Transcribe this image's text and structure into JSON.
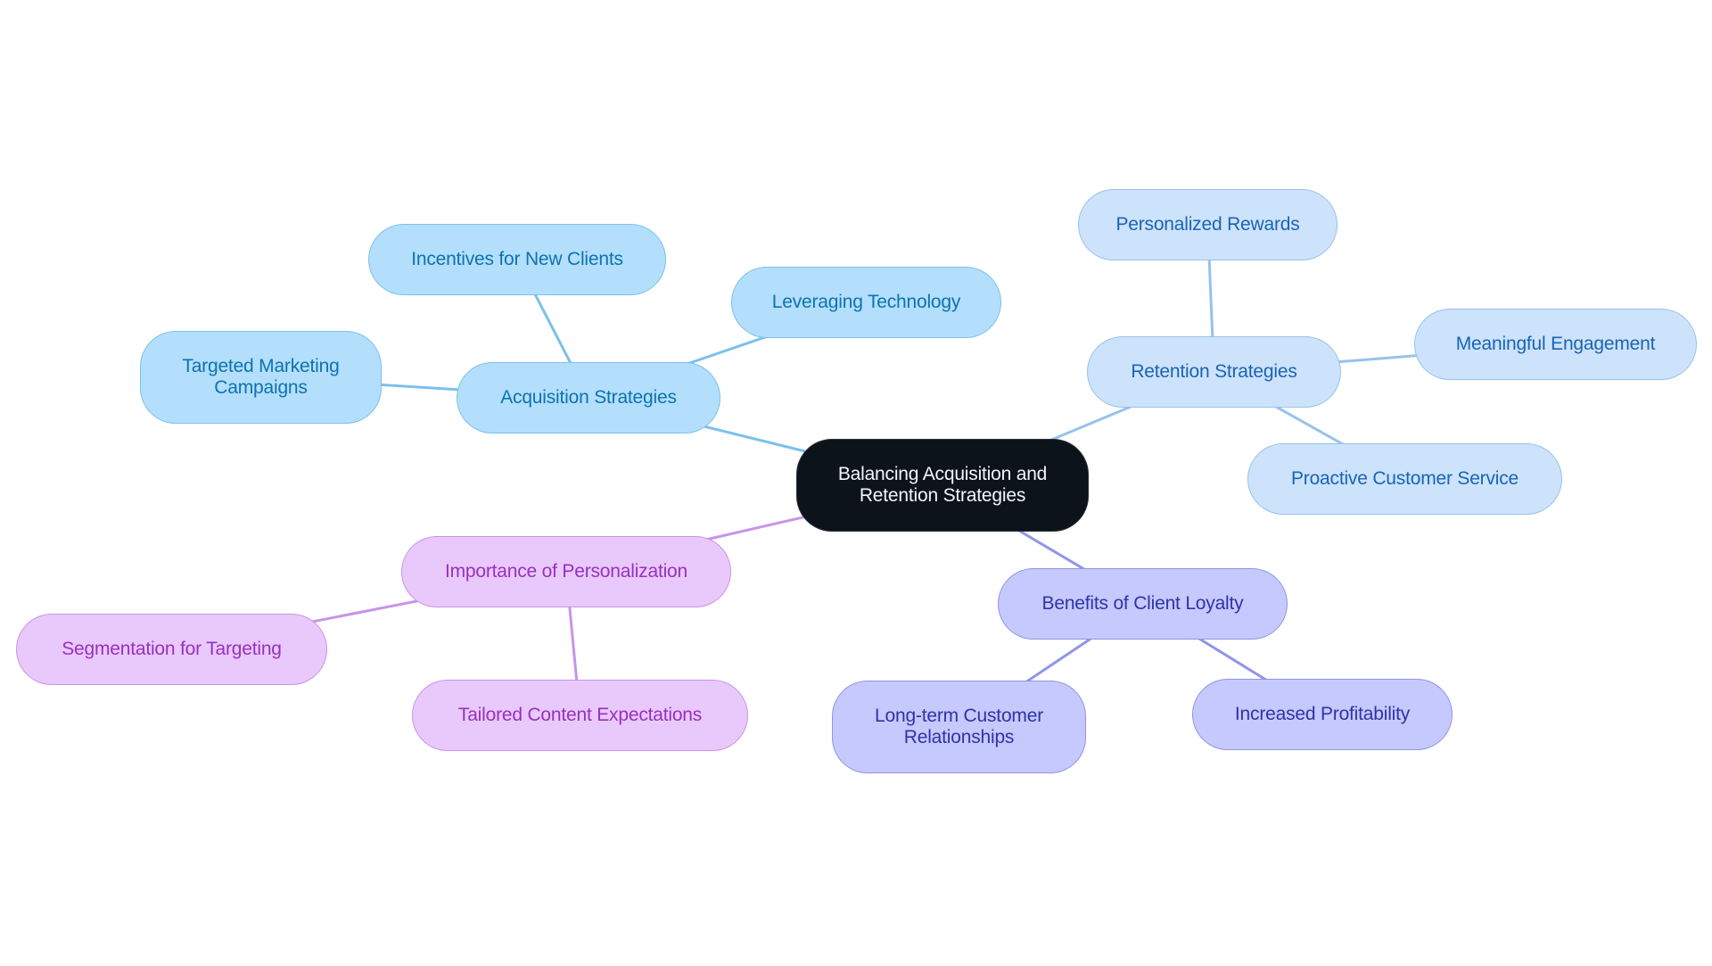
{
  "diagram": {
    "type": "mindmap",
    "root": {
      "id": "root",
      "label": "Balancing Acquisition and Retention Strategies",
      "lines": [
        "Balancing Acquisition and",
        "Retention Strategies"
      ]
    },
    "branches": [
      {
        "id": "acquisition",
        "label": "Acquisition Strategies",
        "color": {
          "fill": "#b3dffd",
          "text": "#0e72b0",
          "edge": "#7cc0ea"
        },
        "children": [
          {
            "id": "acq-incentives",
            "label": "Incentives for New Clients"
          },
          {
            "id": "acq-technology",
            "label": "Leveraging Technology"
          },
          {
            "id": "acq-targeted",
            "label": "Targeted Marketing Campaigns",
            "lines": [
              "Targeted Marketing",
              "Campaigns"
            ]
          }
        ]
      },
      {
        "id": "retention",
        "label": "Retention Strategies",
        "color": {
          "fill": "#cce3fb",
          "text": "#1b63b6",
          "edge": "#97c2ec"
        },
        "children": [
          {
            "id": "ret-rewards",
            "label": "Personalized Rewards"
          },
          {
            "id": "ret-engagement",
            "label": "Meaningful Engagement"
          },
          {
            "id": "ret-service",
            "label": "Proactive Customer Service"
          }
        ]
      },
      {
        "id": "personalization",
        "label": "Importance of Personalization",
        "color": {
          "fill": "#e9c9fc",
          "text": "#9830bf",
          "edge": "#c893ea"
        },
        "children": [
          {
            "id": "per-segmentation",
            "label": "Segmentation for Targeting"
          },
          {
            "id": "per-tailored",
            "label": "Tailored Content Expectations"
          }
        ]
      },
      {
        "id": "loyalty",
        "label": "Benefits of Client Loyalty",
        "color": {
          "fill": "#c6c9fd",
          "text": "#2f33a8",
          "edge": "#9095e6"
        },
        "children": [
          {
            "id": "ben-longterm",
            "label": "Long-term Customer Relationships",
            "lines": [
              "Long-term Customer",
              "Relationships"
            ]
          },
          {
            "id": "ben-profit",
            "label": "Increased Profitability"
          }
        ]
      }
    ],
    "root_color": {
      "fill": "#0c131b",
      "text": "#f4f6f8"
    }
  }
}
